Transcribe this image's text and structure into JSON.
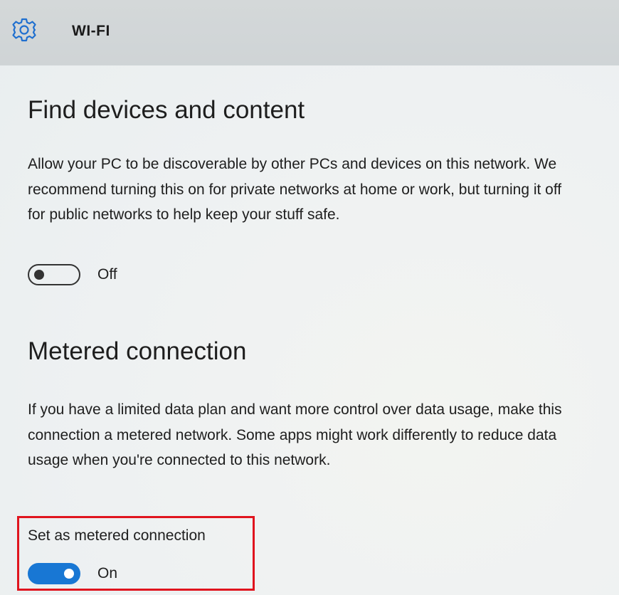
{
  "header": {
    "icon": "gear-icon",
    "title": "WI-FI"
  },
  "find_devices": {
    "heading": "Find devices and content",
    "description": "Allow your PC to be discoverable by other PCs and devices on this network. We recommend turning this on for private networks at home or work, but turning it off for public networks to help keep your stuff safe.",
    "toggle_state": "Off"
  },
  "metered": {
    "heading": "Metered connection",
    "description": "If you have a limited data plan and want more control over data usage, make this connection a metered network. Some apps might work differently to reduce data usage when you're connected to this network.",
    "setting_label": "Set as metered connection",
    "toggle_state": "On"
  },
  "colors": {
    "accent": "#1877d4",
    "highlight": "#e0141e"
  }
}
